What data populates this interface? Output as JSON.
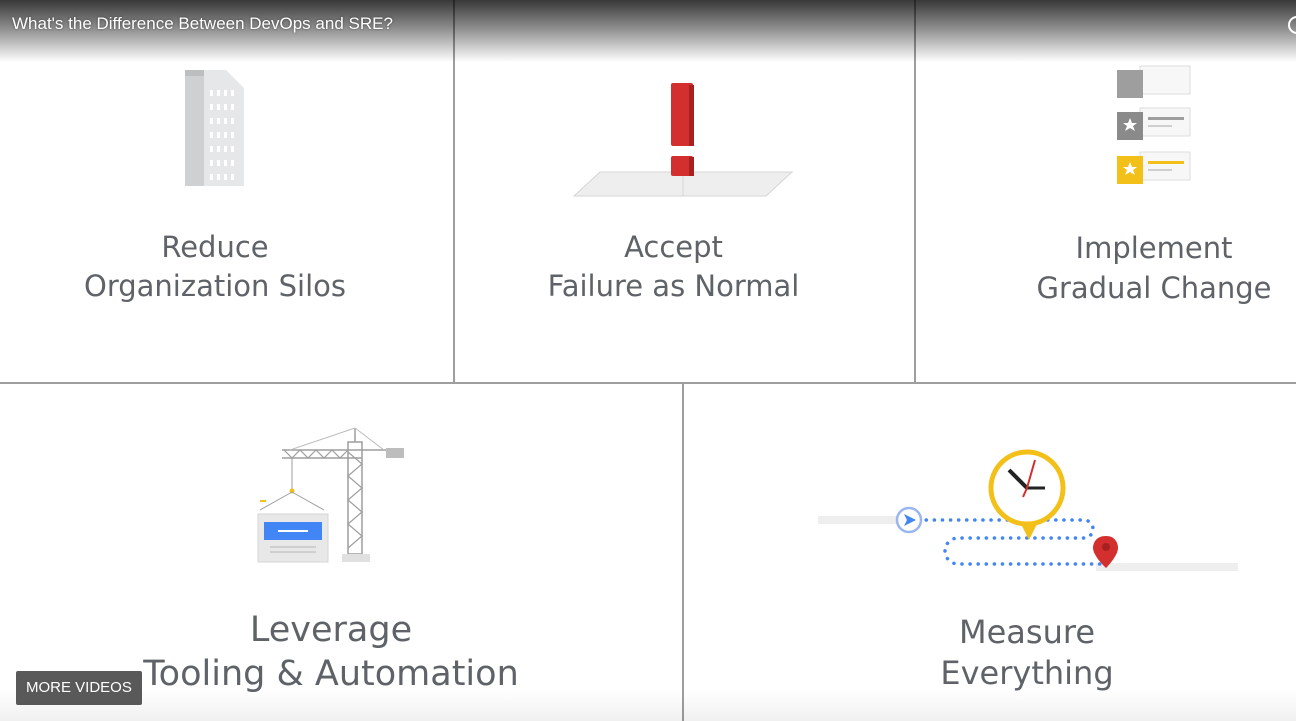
{
  "video": {
    "title": "What's the Difference Between DevOps and SRE?",
    "more_videos_label": "MORE VIDEOS"
  },
  "colors": {
    "text": "#5f6368",
    "divider": "#9e9e9e",
    "red": "#d32f2f",
    "yellow": "#f2c018",
    "blue": "#4285f4",
    "gray": "#bdbdbd"
  },
  "tiles": [
    {
      "line1": "Reduce",
      "line2": "Organization Silos",
      "icon": "building-icon"
    },
    {
      "line1": "Accept",
      "line2": "Failure as Normal",
      "icon": "exclamation-icon"
    },
    {
      "line1": "Implement",
      "line2": "Gradual Change",
      "icon": "stacked-cards-icon"
    },
    {
      "line1": "Leverage",
      "line2": "Tooling & Automation",
      "icon": "crane-icon"
    },
    {
      "line1": "Measure",
      "line2": "Everything",
      "icon": "clock-route-icon"
    }
  ]
}
